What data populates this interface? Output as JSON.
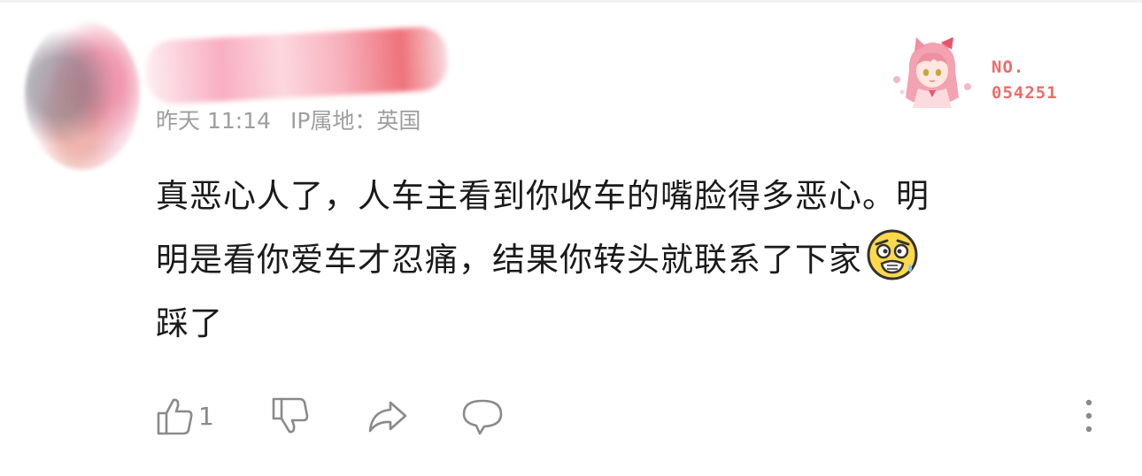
{
  "comment": {
    "meta": {
      "time": "昨天 11:14",
      "ip_location": "IP属地：英国"
    },
    "badge": {
      "label": "NO.",
      "number": "054251"
    },
    "lines": [
      "真恶心人了，人车主看到你收车的嘴脸得多恶心。明",
      "明是看你爱车才忍痛，结果你转头就联系了下家",
      "踩了"
    ],
    "emoji": "astonished-face-icon",
    "actions": {
      "like_count": "1"
    }
  },
  "colors": {
    "meta_text": "#9e9e9e",
    "body_text": "#1a1a1a",
    "badge_accent": "#ef6b6b",
    "icon_gray": "#8a8a8a"
  }
}
